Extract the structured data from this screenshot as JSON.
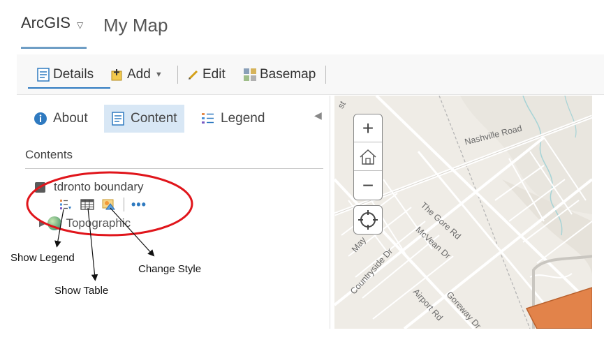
{
  "header": {
    "brand": "ArcGIS",
    "brand_caret": "▽",
    "map_title": "My Map"
  },
  "toolbar": {
    "details_label": "Details",
    "add_label": "Add",
    "edit_label": "Edit",
    "basemap_label": "Basemap"
  },
  "panel": {
    "tabs": [
      {
        "label": "About",
        "icon": "info-icon"
      },
      {
        "label": "Content",
        "icon": "content-list-icon",
        "active": true
      },
      {
        "label": "Legend",
        "icon": "legend-icon"
      }
    ],
    "contents_heading": "Contents",
    "layers": [
      {
        "name": "tdronto boundary",
        "checked": true,
        "tools": [
          "show-legend-icon",
          "show-table-icon",
          "change-style-icon",
          "more-options-icon"
        ],
        "more_label": "•••"
      },
      {
        "name": "Topographic",
        "type": "basemap",
        "icon": "globe-icon"
      }
    ]
  },
  "annotations": {
    "show_legend": "Show Legend",
    "show_table": "Show Table",
    "change_style": "Change Style",
    "ellipse_color": "#e0151b"
  },
  "map": {
    "road_labels": [
      "Nashville Road",
      "The Gore Rd",
      "McVean Dr",
      "Countryside Dr",
      "Airport Rd",
      "Goreway Dr",
      "May",
      "st"
    ],
    "zoom_in": "+",
    "zoom_out": "−",
    "polygon_color": "#e2834a"
  },
  "colors": {
    "accent": "#2f7ac0",
    "active_tab_bg": "#d8e7f5",
    "map_bg": "#efece6"
  }
}
